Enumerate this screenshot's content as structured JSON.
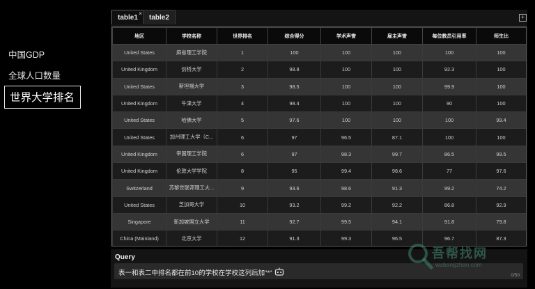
{
  "sidebar": {
    "items": [
      {
        "label": "中国GDP"
      },
      {
        "label": "全球人口数量"
      },
      {
        "label": "世界大学排名"
      }
    ]
  },
  "tabs": [
    {
      "label": "table1",
      "close": "×"
    },
    {
      "label": "table2"
    }
  ],
  "add_icon": "+",
  "table": {
    "columns": [
      "地区",
      "学校名称",
      "世界排名",
      "综合得分",
      "学术声誉",
      "雇主声誉",
      "每位教员引用率",
      "师生比"
    ],
    "rows": [
      [
        "United States",
        "麻省理工学院",
        "1",
        "100",
        "100",
        "100",
        "100",
        "100"
      ],
      [
        "United Kingdom",
        "剑桥大学",
        "2",
        "98.8",
        "100",
        "100",
        "92.3",
        "100"
      ],
      [
        "United States",
        "斯坦福大学",
        "3",
        "98.5",
        "100",
        "100",
        "99.9",
        "100"
      ],
      [
        "United Kingdom",
        "牛津大学",
        "4",
        "98.4",
        "100",
        "100",
        "90",
        "100"
      ],
      [
        "United States",
        "哈佛大学",
        "5",
        "97.6",
        "100",
        "100",
        "100",
        "99.4"
      ],
      [
        "United States",
        "加州理工大学（C...",
        "6",
        "97",
        "96.5",
        "87.1",
        "100",
        "100"
      ],
      [
        "United Kingdom",
        "帝国理工学院",
        "6",
        "97",
        "98.3",
        "99.7",
        "86.5",
        "99.5"
      ],
      [
        "United Kingdom",
        "伦敦大学学院",
        "8",
        "95",
        "99.4",
        "98.6",
        "77",
        "97.6"
      ],
      [
        "Switzerland",
        "苏黎世联邦理工大...",
        "9",
        "93.6",
        "98.6",
        "91.3",
        "99.2",
        "74.2"
      ],
      [
        "United States",
        "芝加哥大学",
        "10",
        "93.2",
        "99.2",
        "92.2",
        "86.8",
        "92.9"
      ],
      [
        "Singapore",
        "新加坡国立大学",
        "11",
        "92.7",
        "99.5",
        "94.1",
        "91.8",
        "79.8"
      ],
      [
        "China (Mainland)",
        "北京大学",
        "12",
        "91.3",
        "99.3",
        "96.5",
        "96.7",
        "87.3"
      ]
    ]
  },
  "query": {
    "label": "Query",
    "text": "表一和表二中排名都在前10的学校在学校这列后加\"*\"",
    "count": "0/50",
    "icon": "robot-icon"
  },
  "watermark": {
    "title": "吾帮找网",
    "url": "wubangzhao.com"
  }
}
